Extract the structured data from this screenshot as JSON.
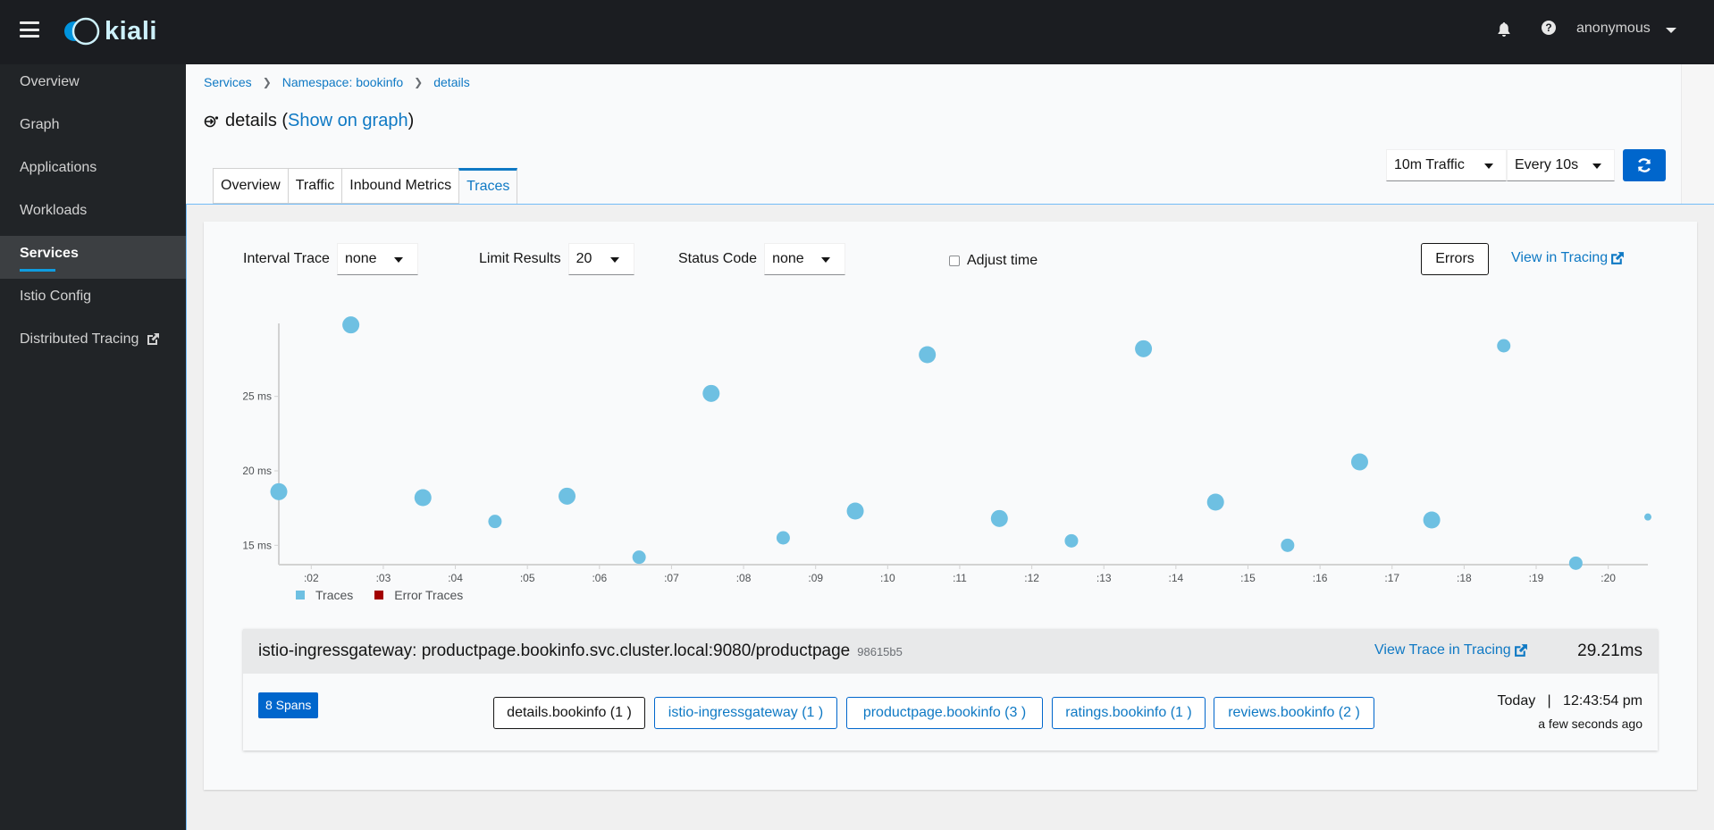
{
  "header": {
    "app_name": "kiali",
    "user": "anonymous"
  },
  "sidebar": {
    "items": [
      {
        "label": "Overview"
      },
      {
        "label": "Graph"
      },
      {
        "label": "Applications"
      },
      {
        "label": "Workloads"
      },
      {
        "label": "Services",
        "active": true
      },
      {
        "label": "Istio Config"
      },
      {
        "label": "Distributed Tracing",
        "external": true
      }
    ]
  },
  "breadcrumb": [
    "Services",
    "Namespace: bookinfo",
    "details"
  ],
  "title": {
    "name": "details",
    "link": "Show on graph"
  },
  "tabs": [
    {
      "label": "Overview"
    },
    {
      "label": "Traffic"
    },
    {
      "label": "Inbound Metrics"
    },
    {
      "label": "Traces",
      "active": true
    }
  ],
  "toolbar": {
    "duration": "10m Traffic",
    "refresh_interval": "Every 10s"
  },
  "filters": {
    "interval_trace_label": "Interval Trace",
    "interval_trace_value": "none",
    "limit_label": "Limit Results",
    "limit_value": "20",
    "status_label": "Status Code",
    "status_value": "none",
    "adjust_time_label": "Adjust time",
    "adjust_time_checked": false,
    "errors_button": "Errors",
    "view_in_tracing": "View in Tracing"
  },
  "chart_data": {
    "type": "scatter",
    "title": "",
    "xlabel": "",
    "ylabel": "",
    "x_tick_labels": [
      ":02",
      ":03",
      ":04",
      ":05",
      ":06",
      ":07",
      ":08",
      ":09",
      ":10",
      ":11",
      ":12",
      ":13",
      ":14",
      ":15",
      ":16",
      ":17",
      ":18",
      ":19",
      ":20"
    ],
    "x_ticks_seconds": [
      2,
      3,
      4,
      5,
      6,
      7,
      8,
      9,
      10,
      11,
      12,
      13,
      14,
      15,
      16,
      17,
      18,
      19,
      20
    ],
    "y_tick_labels": [
      "15 ms",
      "20 ms",
      "25 ms"
    ],
    "y_ticks": [
      15,
      20,
      25
    ],
    "xlim_seconds": [
      1.55,
      20.55
    ],
    "ylim": [
      13.7,
      29.9
    ],
    "grid": false,
    "legend_position": "bottom-left",
    "legend": [
      {
        "name": "Traces",
        "color": "#6ec0e2"
      },
      {
        "name": "Error Traces",
        "color": "#a30000"
      }
    ],
    "series": [
      {
        "name": "Traces",
        "x_seconds": [
          1.55,
          2.55,
          3.55,
          4.55,
          5.55,
          6.55,
          7.55,
          8.55,
          9.55,
          10.55,
          11.55,
          12.55,
          13.55,
          14.55,
          15.55,
          16.55,
          17.55,
          18.55,
          19.55,
          20.55
        ],
        "values_ms": [
          18.6,
          29.8,
          18.2,
          16.6,
          18.3,
          14.2,
          25.2,
          15.5,
          17.3,
          27.8,
          16.8,
          15.3,
          28.2,
          17.9,
          15.0,
          20.6,
          16.7,
          28.4,
          13.8,
          16.9
        ],
        "relative_size": [
          3,
          3,
          3,
          2,
          3,
          2,
          3,
          2,
          3,
          3,
          3,
          2,
          3,
          3,
          2,
          3,
          3,
          2,
          2,
          1
        ]
      },
      {
        "name": "Error Traces",
        "x_seconds": [],
        "values_ms": []
      }
    ]
  },
  "selected_trace": {
    "name": "istio-ingressgateway: productpage.bookinfo.svc.cluster.local:9080/productpage",
    "id": "98615b5",
    "view_link": "View Trace in Tracing",
    "duration": "29.21ms",
    "spans_badge": "8 Spans",
    "services": [
      {
        "label": "details.bookinfo (1 )",
        "current": true
      },
      {
        "label": "istio-ingressgateway (1 )"
      },
      {
        "label": "productpage.bookinfo (3 )"
      },
      {
        "label": "ratings.bookinfo (1 )"
      },
      {
        "label": "reviews.bookinfo (2 )"
      }
    ],
    "date": "Today   |   12:43:54 pm",
    "ago": "a few seconds ago"
  }
}
